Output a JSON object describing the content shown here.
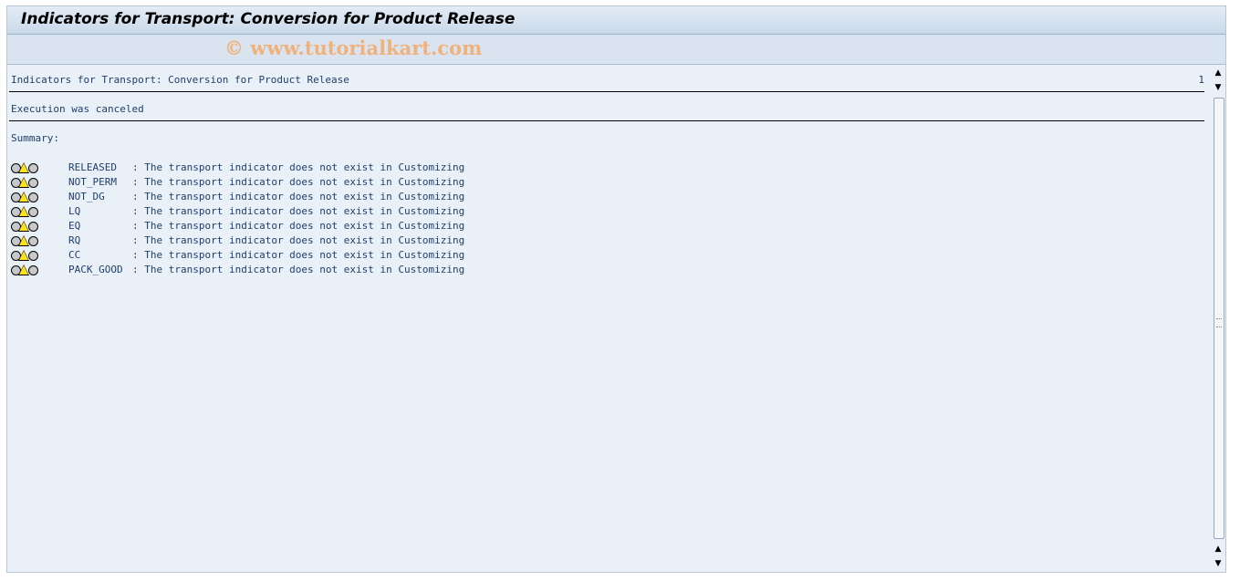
{
  "window": {
    "title": "Indicators for Transport: Conversion for Product Release",
    "watermark": "© www.tutorialkart.com"
  },
  "report": {
    "header": "Indicators for Transport: Conversion for Product Release",
    "page_number": "1",
    "status": "Execution was canceled",
    "summary_label": "Summary:",
    "rows": [
      {
        "indicator": "RELEASED",
        "message": ": The transport indicator does not exist in Customizing"
      },
      {
        "indicator": "NOT_PERM",
        "message": ": The transport indicator does not exist in Customizing"
      },
      {
        "indicator": "NOT_DG",
        "message": ": The transport indicator does not exist in Customizing"
      },
      {
        "indicator": "LQ",
        "message": ": The transport indicator does not exist in Customizing"
      },
      {
        "indicator": "EQ",
        "message": ": The transport indicator does not exist in Customizing"
      },
      {
        "indicator": "RQ",
        "message": ": The transport indicator does not exist in Customizing"
      },
      {
        "indicator": "CC",
        "message": ": The transport indicator does not exist in Customizing"
      },
      {
        "indicator": "PACK_GOOD",
        "message": ": The transport indicator does not exist in Customizing"
      }
    ],
    "row_icon": "traffic-light-yellow-icon"
  },
  "scrollbar": {
    "up_arrow": "▲",
    "down_arrow": "▼"
  },
  "colors": {
    "text": "#1f3f6a",
    "background": "#e9f0f7",
    "warning_yellow": "#f7e21b"
  }
}
